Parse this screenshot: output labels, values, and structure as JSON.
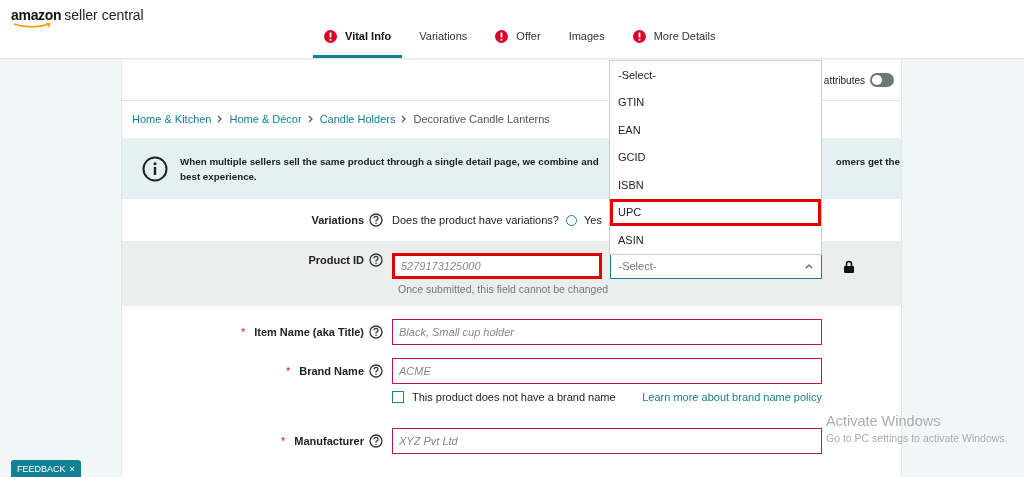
{
  "logo": {
    "brand": "amazon",
    "product": "seller central"
  },
  "tabs": [
    {
      "label": "Vital Info",
      "selected": true,
      "alert": true
    },
    {
      "label": "Variations",
      "selected": false,
      "alert": false
    },
    {
      "label": "Offer",
      "selected": false,
      "alert": true
    },
    {
      "label": "Images",
      "selected": false,
      "alert": false
    },
    {
      "label": "More Details",
      "selected": false,
      "alert": true
    }
  ],
  "toolbar": {
    "label": "attributes",
    "toggle_on": false
  },
  "breadcrumb": [
    "Home & Kitchen",
    "Home & Décor",
    "Candle Holders",
    "Decorative Candle Lanterns"
  ],
  "banner": {
    "line1_left": "When multiple sellers sell the same product through a single detail page, we combine and",
    "line1_right": "omers get the",
    "line2": "best experience."
  },
  "variations": {
    "label": "Variations",
    "question": "Does the product have variations?",
    "option": "Yes",
    "selected": false
  },
  "product_id": {
    "label": "Product ID",
    "placeholder": "5279173125000",
    "highlighted": true,
    "note": "Once submitted, this field cannot be changed",
    "type_select": {
      "value": "-Select-",
      "expanded": true
    },
    "options": [
      {
        "label": "-Select-",
        "highlighted": false
      },
      {
        "label": "GTIN",
        "highlighted": false
      },
      {
        "label": "EAN",
        "highlighted": false
      },
      {
        "label": "GCID",
        "highlighted": false
      },
      {
        "label": "ISBN",
        "highlighted": false
      },
      {
        "label": "UPC",
        "highlighted": true
      },
      {
        "label": "ASIN",
        "highlighted": false
      }
    ]
  },
  "fields": [
    {
      "kind": "text",
      "label": "Item Name (aka Title)",
      "required_mark": "*",
      "placeholder": "Black, Small cup holder"
    },
    {
      "kind": "brand",
      "label": "Brand Name",
      "required_mark": "*",
      "placeholder": "ACME",
      "checkbox": {
        "label": "This product does not have a brand name",
        "checked": false
      },
      "link": "Learn more about brand name policy"
    },
    {
      "kind": "text",
      "label": "Manufacturer",
      "required_mark": "*",
      "placeholder": "XYZ Pvt Ltd"
    }
  ],
  "feedback": {
    "label": "FEEDBACK",
    "close": "×"
  },
  "os_notice": {
    "title": "Activate Windows",
    "text": "Go to PC settings to activate Windows."
  }
}
